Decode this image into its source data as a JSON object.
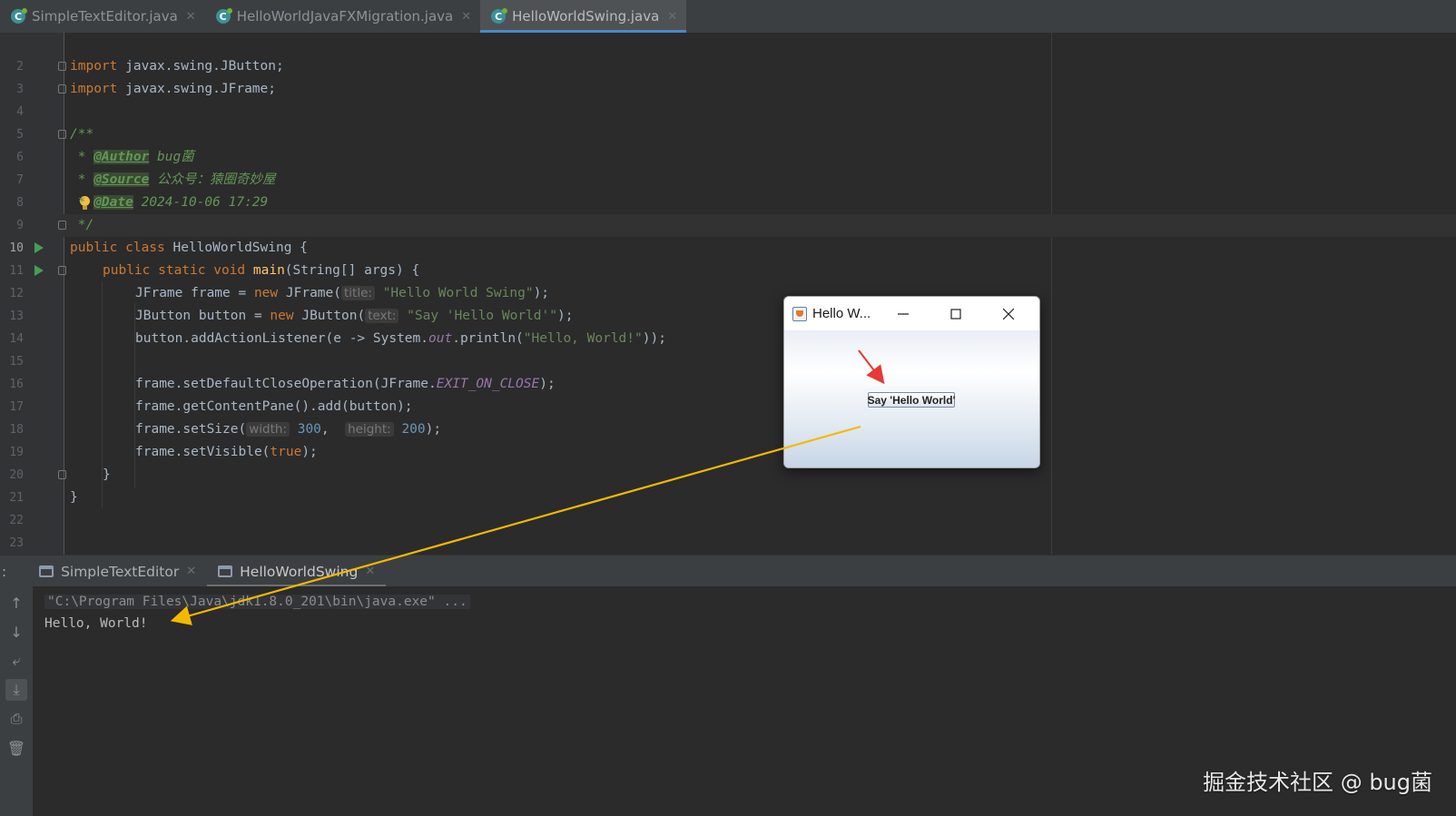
{
  "tabs": [
    {
      "label": "SimpleTextEditor.java",
      "active": false
    },
    {
      "label": "HelloWorldJavaFXMigration.java",
      "active": false
    },
    {
      "label": "HelloWorldSwing.java",
      "active": true
    }
  ],
  "code": {
    "current_line": "10",
    "lines": {
      "l2": {
        "num": "2"
      },
      "l3": {
        "num": "3",
        "kw": "import",
        "rest": " javax.swing.JButton;"
      },
      "l4": {
        "num": "4",
        "kw": "import",
        "rest": " javax.swing.JFrame;"
      },
      "l5": {
        "num": "5"
      },
      "l6": {
        "num": "6",
        "text": "/**"
      },
      "l7": {
        "num": "7",
        "star": " * ",
        "tag": "@Author",
        "val": " bug菌"
      },
      "l8": {
        "num": "8",
        "star": " * ",
        "tag": "@Source",
        "val": " 公众号：猿圈奇妙屋"
      },
      "l9": {
        "num": "9",
        "star": " * ",
        "tag": "@Date",
        "val": " 2024-10-06 17:29"
      },
      "l10": {
        "num": "10",
        "text": " */"
      },
      "l11": {
        "num": "11",
        "kw": "public class",
        "rest": " HelloWorldSwing {"
      },
      "l12": {
        "num": "12",
        "kw": "public static void",
        "fn": "main",
        "rest": "(String[] args) {"
      },
      "l13": {
        "num": "13",
        "a": "JFrame frame = ",
        "kw": "new",
        "b": " JFrame(",
        "hint": "title:",
        "str": "\"Hello World Swing\"",
        "c": ");"
      },
      "l14": {
        "num": "14",
        "a": "JButton button = ",
        "kw": "new",
        "b": " JButton(",
        "hint": "text:",
        "str": "\"Say 'Hello World'\"",
        "c": ");"
      },
      "l15": {
        "num": "15",
        "a": "button.addActionListener(e -> System.",
        "st": "out",
        "b": ".println(",
        "str": "\"Hello, World!\"",
        "c": "));"
      },
      "l16": {
        "num": "16"
      },
      "l17": {
        "num": "17",
        "a": "frame.setDefaultCloseOperation(JFrame.",
        "st": "EXIT_ON_CLOSE",
        "c": ");"
      },
      "l18": {
        "num": "18",
        "a": "frame.getContentPane().add(button);"
      },
      "l19": {
        "num": "19",
        "a": "frame.setSize(",
        "hint1": "width:",
        "n1": "300",
        "sep": ", ",
        "hint2": "height:",
        "n2": "200",
        "c": ");"
      },
      "l20": {
        "num": "20",
        "a": "frame.setVisible(",
        "kw": "true",
        "c": ");"
      },
      "l21": {
        "num": "21",
        "text": "}"
      },
      "l22": {
        "num": "22",
        "text": "}"
      },
      "l23": {
        "num": "23"
      }
    }
  },
  "run_panel": {
    "colon": ":",
    "tabs": [
      {
        "label": "SimpleTextEditor",
        "active": false
      },
      {
        "label": "HelloWorldSwing",
        "active": true
      }
    ],
    "console": {
      "command": "\"C:\\Program Files\\Java\\jdk1.8.0_201\\bin\\java.exe\" ...",
      "output": "Hello, World!"
    }
  },
  "swing_window": {
    "title": "Hello W...",
    "button_label": "Say 'Hello World'"
  },
  "colors": {
    "arrow_yellow": "#f5b800",
    "arrow_red": "#e53935",
    "accent_blue": "#4a88c7"
  },
  "watermark": "掘金技术社区 @ bug菌"
}
